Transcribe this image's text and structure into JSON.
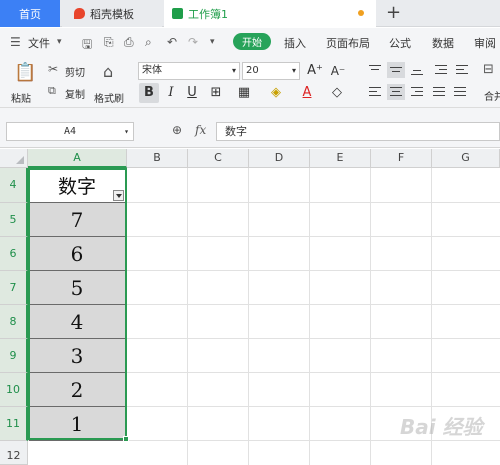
{
  "tabs": {
    "home": "首页",
    "templates": "稻壳模板",
    "workbook": "工作簿1",
    "new_tab": "+"
  },
  "menu": {
    "file": "文件",
    "start": "开始",
    "insert": "插入",
    "page_layout": "页面布局",
    "formulas": "公式",
    "data": "数据",
    "review": "审阅"
  },
  "ribbon": {
    "paste": "粘贴",
    "cut": "剪切",
    "copy": "复制",
    "format_painter": "格式刷",
    "font_name": "宋体",
    "font_size": "20",
    "merge": "合并"
  },
  "formula_bar": {
    "cell_ref": "A4",
    "fx": "fx",
    "content": "数字"
  },
  "columns": [
    "A",
    "B",
    "C",
    "D",
    "E",
    "F",
    "G"
  ],
  "rows": [
    "4",
    "5",
    "6",
    "7",
    "8",
    "9",
    "10",
    "11",
    "12"
  ],
  "cells": {
    "A4": "数字",
    "A5": "7",
    "A6": "6",
    "A7": "5",
    "A8": "4",
    "A9": "3",
    "A10": "2",
    "A11": "1"
  },
  "colors": {
    "accent_blue": "#3c80f5",
    "accent_green": "#27a35a",
    "selection": "#2a9a52",
    "cell_fill": "#d9d9d9"
  },
  "watermark": "Bai 经验"
}
